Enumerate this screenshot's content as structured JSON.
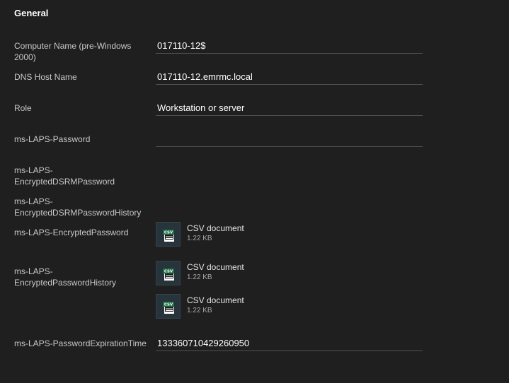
{
  "section": {
    "title": "General"
  },
  "rows": {
    "computer_name": {
      "label": "Computer Name (pre-Windows 2000)",
      "value": "017110-12$"
    },
    "dns_host_name": {
      "label": "DNS Host Name",
      "value": "017110-12.emrmc.local"
    },
    "role": {
      "label": "Role",
      "value": "Workstation or server"
    },
    "laps_password": {
      "label": "ms-LAPS-Password",
      "value": ""
    },
    "encrypted_dsrm_password": {
      "label": "ms-LAPS-EncryptedDSRMPassword"
    },
    "encrypted_dsrm_password_history": {
      "label": "ms-LAPS-EncryptedDSRMPasswordHistory"
    },
    "encrypted_password": {
      "label": "ms-LAPS-EncryptedPassword",
      "files": [
        {
          "name": "CSV document",
          "size": "1.22 KB",
          "icon": "csv-file-icon"
        }
      ]
    },
    "encrypted_password_history": {
      "label": "ms-LAPS-EncryptedPasswordHistory",
      "files": [
        {
          "name": "CSV document",
          "size": "1.22 KB",
          "icon": "csv-file-icon"
        },
        {
          "name": "CSV document",
          "size": "1.22 KB",
          "icon": "csv-file-icon"
        }
      ]
    },
    "password_expiration_time": {
      "label": "ms-LAPS-PasswordExpirationTime",
      "value": "133360710429260950"
    }
  },
  "colors": {
    "background": "#1f1f1f",
    "label_text": "#c8c8c8",
    "value_text": "#ffffff",
    "underline": "#505050",
    "icon_box": "#27343b",
    "csv_green": "#1e7145"
  }
}
